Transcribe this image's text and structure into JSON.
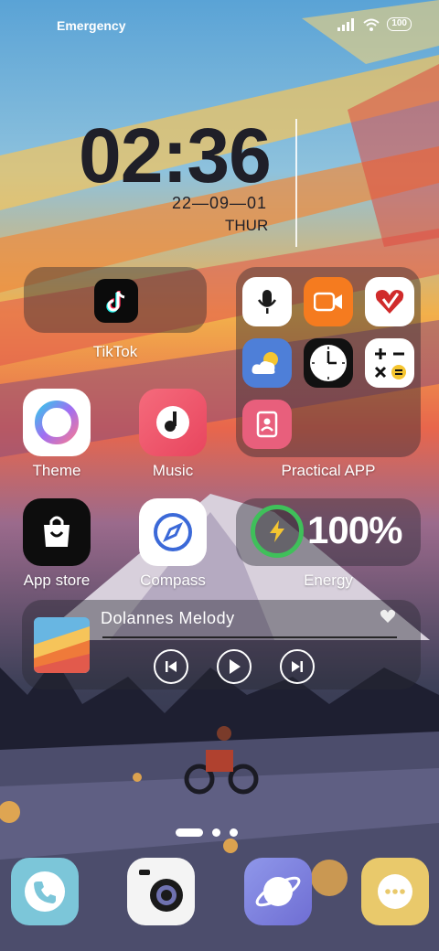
{
  "status_bar": {
    "carrier_text": "Emergency",
    "battery_level": "100"
  },
  "clock": {
    "time": "02:36",
    "date": "22—09—01",
    "day": "THUR"
  },
  "apps": {
    "tiktok": "TikTok",
    "theme": "Theme",
    "music": "Music",
    "practical_folder": "Practical APP",
    "app_store": "App store",
    "compass": "Compass",
    "energy": "Energy"
  },
  "folder_apps": [
    "recorder-icon",
    "video-icon",
    "health-icon",
    "weather-icon",
    "clock-icon",
    "calculator-icon",
    "contacts-icon"
  ],
  "energy_widget": {
    "percent": "100%"
  },
  "music_player": {
    "track_title": "Dolannes Melody",
    "progress": 0
  },
  "dock": [
    "phone-icon",
    "camera-icon",
    "browser-icon",
    "more-icon"
  ],
  "page_indicator": {
    "pages": 3,
    "current": 1
  }
}
